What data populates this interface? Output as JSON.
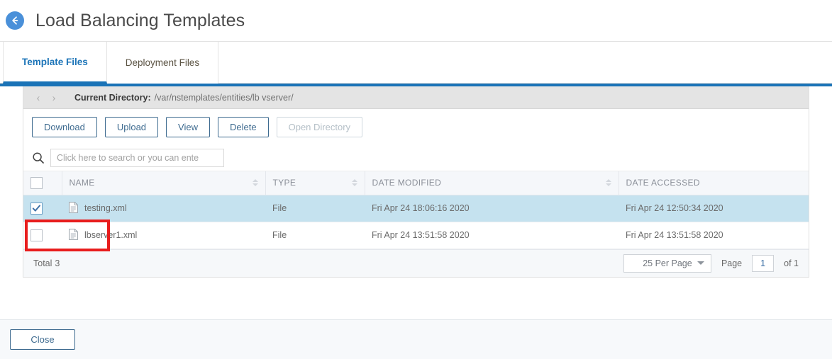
{
  "header": {
    "back_icon": "back-arrow-icon",
    "title": "Load Balancing Templates"
  },
  "tabs": [
    {
      "label": "Template Files",
      "active": true
    },
    {
      "label": "Deployment Files",
      "active": false
    }
  ],
  "directory_bar": {
    "prev_icon": "chevron-left-icon",
    "next_icon": "chevron-right-icon",
    "label": "Current Directory:",
    "path": "/var/nstemplates/entities/lb vserver/"
  },
  "actions": [
    {
      "label": "Download",
      "disabled": false,
      "highlighted": true
    },
    {
      "label": "Upload",
      "disabled": false,
      "highlighted": false
    },
    {
      "label": "View",
      "disabled": false,
      "highlighted": false
    },
    {
      "label": "Delete",
      "disabled": false,
      "highlighted": false
    },
    {
      "label": "Open Directory",
      "disabled": true,
      "highlighted": false
    }
  ],
  "search": {
    "icon": "search-icon",
    "value": "",
    "placeholder": "Click here to search or you can ente"
  },
  "table": {
    "columns": [
      {
        "label": "",
        "sortable": false
      },
      {
        "label": "NAME",
        "sortable": true
      },
      {
        "label": "TYPE",
        "sortable": true
      },
      {
        "label": "DATE MODIFIED",
        "sortable": true
      },
      {
        "label": "DATE ACCESSED",
        "sortable": false
      }
    ],
    "rows": [
      {
        "checked": true,
        "selected": true,
        "name": "testing.xml",
        "type": "File",
        "date_modified": "Fri Apr 24 18:06:16 2020",
        "date_accessed": "Fri Apr 24 12:50:34 2020"
      },
      {
        "checked": false,
        "selected": false,
        "name": "lbserver1.xml",
        "type": "File",
        "date_modified": "Fri Apr 24 13:51:58 2020",
        "date_accessed": "Fri Apr 24 13:51:58 2020"
      }
    ]
  },
  "table_footer": {
    "total_label": "Total",
    "total_count": "3",
    "per_page": "25 Per Page",
    "page_label": "Page",
    "page_value": "1",
    "of_label": "of 1"
  },
  "footer": {
    "close_label": "Close"
  },
  "colors": {
    "accent_blue": "#1a73b7",
    "button_blue": "#3d6a8f",
    "selected_row": "#c5e2ef",
    "annotation_red": "#e81d1d",
    "back_circle": "#4a90d9"
  }
}
